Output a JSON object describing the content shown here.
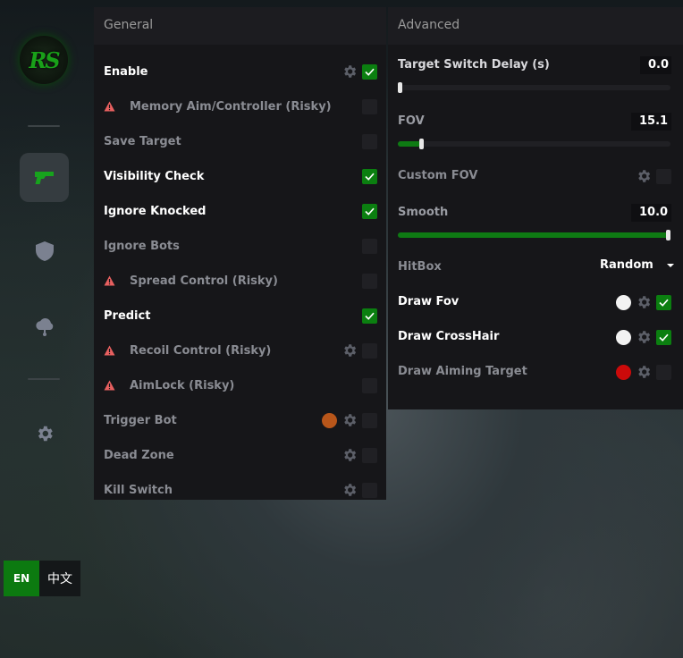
{
  "logo": {
    "text": "RS"
  },
  "sidebar": {
    "items": [
      {
        "name": "aim",
        "icon": "gun-icon",
        "active": true
      },
      {
        "name": "visuals",
        "icon": "shield-icon",
        "active": false
      },
      {
        "name": "misc",
        "icon": "cloud-icon",
        "active": false
      },
      {
        "name": "settings",
        "icon": "gear-icon",
        "active": false
      }
    ]
  },
  "language": {
    "en": "EN",
    "zh": "中文",
    "selected": "EN"
  },
  "colors": {
    "accent": "#0b7f10",
    "panel": "#161619",
    "header": "#1c1c20",
    "warn": "#e86060"
  },
  "general": {
    "title": "General",
    "items": [
      {
        "label": "Enable",
        "checked": true,
        "gear": true,
        "warn": false
      },
      {
        "label": "Memory Aim/Controller (Risky)",
        "checked": false,
        "gear": false,
        "warn": true
      },
      {
        "label": "Save Target",
        "checked": false,
        "gear": false,
        "warn": false
      },
      {
        "label": "Visibility Check",
        "checked": true,
        "gear": false,
        "warn": false
      },
      {
        "label": "Ignore Knocked",
        "checked": true,
        "gear": false,
        "warn": false
      },
      {
        "label": "Ignore Bots",
        "checked": false,
        "gear": false,
        "warn": false
      },
      {
        "label": "Spread Control (Risky)",
        "checked": false,
        "gear": false,
        "warn": true
      },
      {
        "label": "Predict",
        "checked": true,
        "gear": false,
        "warn": false
      },
      {
        "label": "Recoil Control (Risky)",
        "checked": false,
        "gear": true,
        "warn": true
      },
      {
        "label": "AimLock (Risky)",
        "checked": false,
        "gear": false,
        "warn": true
      },
      {
        "label": "Trigger Bot",
        "checked": false,
        "gear": true,
        "warn": false,
        "color": "#b8561a"
      },
      {
        "label": "Dead Zone",
        "checked": false,
        "gear": true,
        "warn": false
      },
      {
        "label": "Kill Switch",
        "checked": false,
        "gear": true,
        "warn": false
      }
    ]
  },
  "advanced": {
    "title": "Advanced",
    "target_switch_delay": {
      "label": "Target Switch Delay (s)",
      "value": "0.0",
      "fraction": 0.0
    },
    "fov": {
      "label": "FOV",
      "value": "15.1",
      "fraction": 0.085
    },
    "custom_fov": {
      "label": "Custom FOV",
      "checked": false
    },
    "smooth": {
      "label": "Smooth",
      "value": "10.0",
      "fraction": 1.0
    },
    "hitbox": {
      "label": "HitBox",
      "value": "Random"
    },
    "draw_fov": {
      "label": "Draw Fov",
      "checked": true,
      "color": "#f2f2f2"
    },
    "draw_crosshair": {
      "label": "Draw CrossHair",
      "checked": true,
      "color": "#f2f2f2"
    },
    "draw_aiming_target": {
      "label": "Draw Aiming Target",
      "checked": false,
      "color": "#cc0a0a"
    }
  }
}
